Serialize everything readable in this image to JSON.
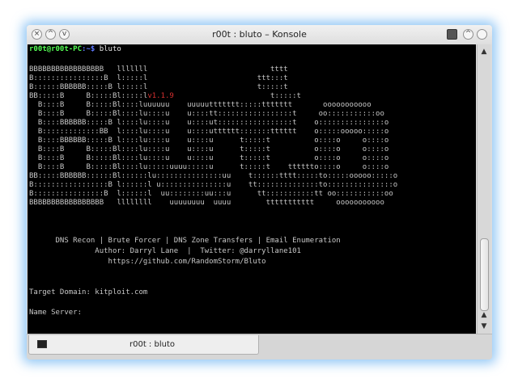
{
  "window": {
    "title": "r00t : bluto – Konsole",
    "controls": [
      "help-icon",
      "minimize-icon",
      "maximize-icon",
      "scrollback-icon",
      "restore-icon",
      "close-icon"
    ]
  },
  "terminal": {
    "prompt_user": "r00t@r00t-PC",
    "prompt_path": ":~$",
    "command": " bluto",
    "banner_pre": "BBBBBBBBBBBBBBBBB   lllllll                            tttt\nB::::::::::::::::B  l:::::l                         ttt:::t\nB::::::BBBBBB:::::B l:::::l                         t:::::t\nBB:::::B     B:::::Bl:::::l",
    "banner_version": "v1.1.9",
    "banner_post": "                      t:::::t\n  B::::B     B:::::Bl::::luuuuuu    uuuuuttttttt:::::ttttttt       ooooooooooo\n  B::::B     B:::::Bl::::lu::::u    u::::tt:::::::::::::::::t     oo:::::::::::oo\n  B::::BBBBBB:::::B l::::lu::::u    u::::ut:::::::::::::::::t    o:::::::::::::::o\n  B:::::::::::::BB  l::::lu::::u    u::::utttttt:::::::tttttt    o:::::ooooo:::::o\n  B::::BBBBBB:::::B l::::lu::::u    u::::u      t:::::t          o::::o     o::::o\n  B::::B     B:::::Bl::::lu::::u    u::::u      t:::::t          o::::o     o::::o\n  B::::B     B:::::Bl::::lu::::u    u::::u      t:::::t          o::::o     o::::o\n  B::::B     B:::::Bl::::lu:::::uuuu:::::u      t:::::t    tttttto::::o     o::::o\nBB:::::BBBBBB::::::Bl::::::lu:::::::::::::::uu    t::::::tttt:::::to:::::ooooo:::::o\nB:::::::::::::::::B l::::::l u:::::::::::::::u    tt::::::::::::::to:::::::::::::::o\nB::::::::::::::::B  l::::::l  uu::::::::uu:::u      tt:::::::::::tt oo:::::::::::oo\nBBBBBBBBBBBBBBBBB   llllllll    uuuuuuuu  uuuu        ttttttttttt     ooooooooooo",
    "menu": "      DNS Recon | Brute Forcer | DNS Zone Transfers | Email Enumeration",
    "author": "               Author: Darryl Lane  |  Twitter: @darryllane101",
    "url": "                  https://github.com/RandomStorm/Bluto",
    "target": "Target Domain: kitploit.com",
    "nameserver": "Name Server:"
  },
  "tab": {
    "label": "r00t : bluto"
  }
}
